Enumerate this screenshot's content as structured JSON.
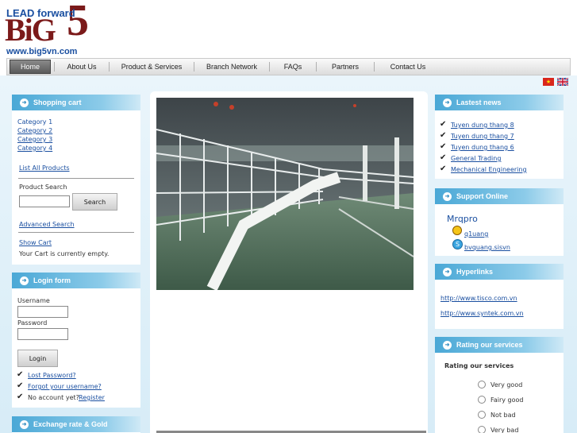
{
  "header": {
    "logo_tagline": "LEAD forward",
    "logo_big": "BiG",
    "logo_five": "5",
    "logo_url": "www.big5vn.com"
  },
  "nav": {
    "items": [
      {
        "label": "Home",
        "active": true
      },
      {
        "label": "About Us"
      },
      {
        "label": "Product & Services"
      },
      {
        "label": "Branch Network"
      },
      {
        "label": "FAQs"
      },
      {
        "label": "Partners"
      },
      {
        "label": "Contact Us"
      }
    ]
  },
  "flags": {
    "vn_icon": "vietnam-flag-icon",
    "gb_icon": "uk-flag-icon"
  },
  "cart": {
    "title": "Shopping cart",
    "categories": [
      "Category 1",
      "Category 2",
      "Category 3",
      "Category 4"
    ],
    "list_all": "List All Products",
    "search_label": "Product Search",
    "search_button": "Search",
    "advanced_search": "Advanced Search",
    "show_cart": "Show Cart",
    "cart_status": "Your Cart is currently empty."
  },
  "login": {
    "title": "Login form",
    "username_label": "Username",
    "password_label": "Password",
    "login_button": "Login",
    "lost_password": "Lost Password?",
    "forgot_username": "Forgot your username?",
    "no_account": "No account yet?",
    "register": "Register"
  },
  "exchange": {
    "title": "Exchange rate & Gold"
  },
  "news": {
    "title": "Lastest news",
    "items": [
      "Tuyen dung thang 8",
      "Tuyen dung thang 7",
      "Tuyen dung thang 6",
      "General Trading",
      "Mechanical Engineering"
    ]
  },
  "support": {
    "title": "Support Online",
    "name": "Mrqpro",
    "yahoo": "q1uang",
    "skype": "bvquang.sisvn"
  },
  "hyperlinks": {
    "title": "Hyperlinks",
    "items": [
      "http://www.tisco.com.vn",
      "http://www.syntek.com.vn"
    ]
  },
  "rating": {
    "title": "Rating our services",
    "question": "Rating our services",
    "options": [
      "Very good",
      "Fairy good",
      "Not bad",
      "Very bad"
    ]
  },
  "colors": {
    "accent": "#4aa8d6",
    "link": "#1a4fa0",
    "brand": "#7b1a1a"
  }
}
